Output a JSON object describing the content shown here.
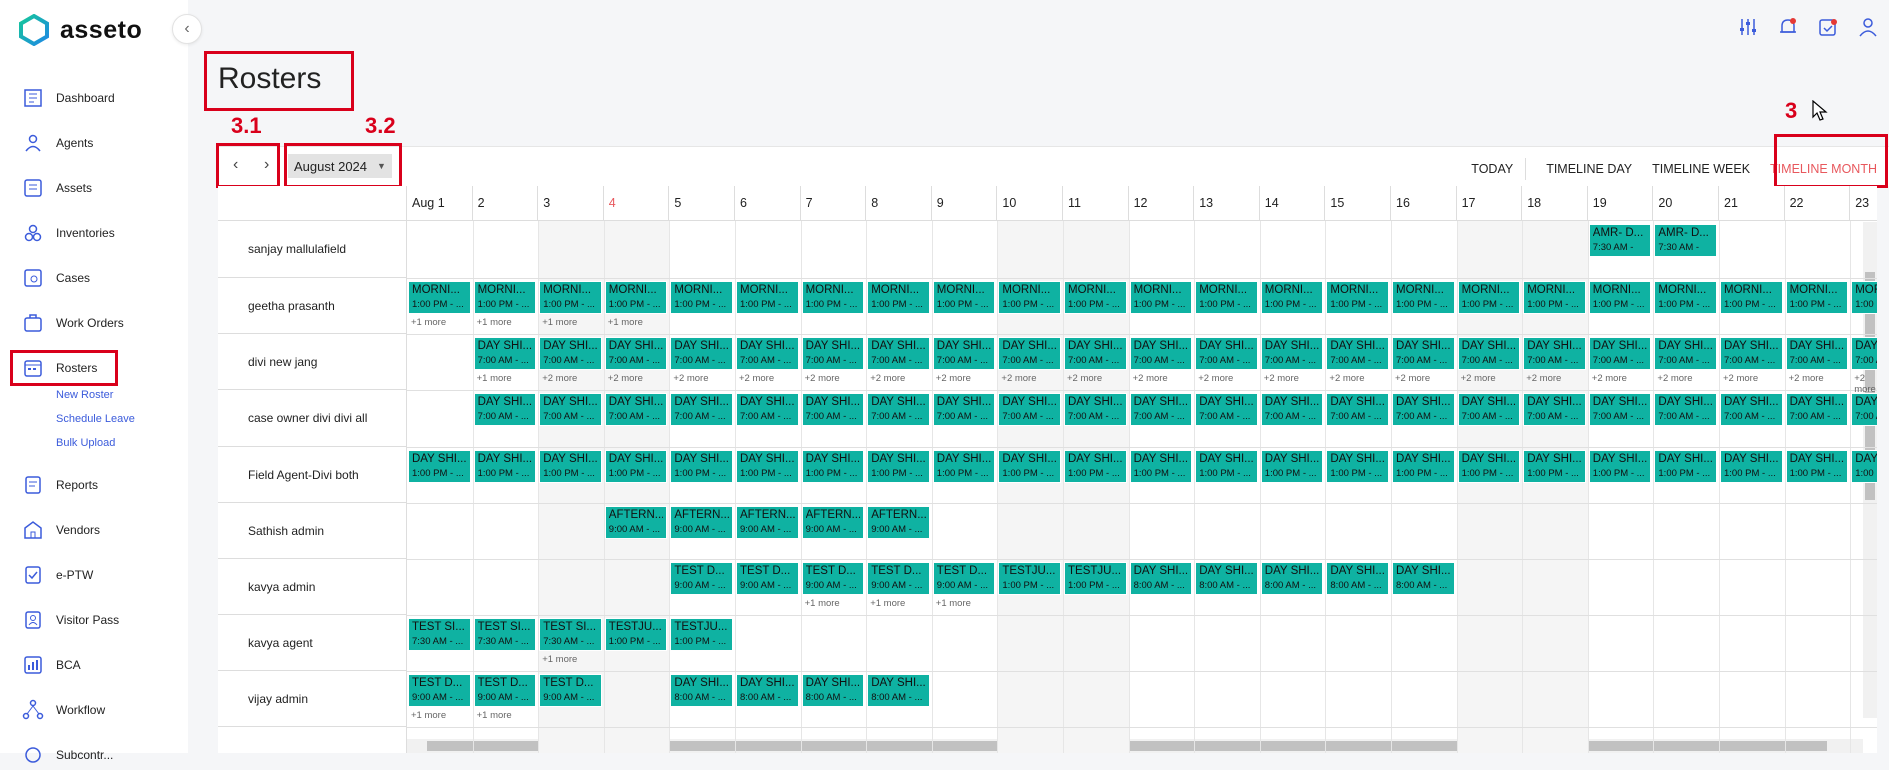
{
  "brand": {
    "name": "asseto"
  },
  "sidebar": {
    "items": [
      {
        "label": "Dashboard",
        "icon": "dashboard-icon"
      },
      {
        "label": "Agents",
        "icon": "agents-icon"
      },
      {
        "label": "Assets",
        "icon": "assets-icon"
      },
      {
        "label": "Inventories",
        "icon": "inventories-icon"
      },
      {
        "label": "Cases",
        "icon": "cases-icon"
      },
      {
        "label": "Work Orders",
        "icon": "work-orders-icon"
      },
      {
        "label": "Rosters",
        "icon": "rosters-icon"
      },
      {
        "label": "Reports",
        "icon": "reports-icon"
      },
      {
        "label": "Vendors",
        "icon": "vendors-icon"
      },
      {
        "label": "e-PTW",
        "icon": "eptw-icon"
      },
      {
        "label": "Visitor Pass",
        "icon": "visitor-pass-icon"
      },
      {
        "label": "BCA",
        "icon": "bca-icon"
      },
      {
        "label": "Workflow",
        "icon": "workflow-icon"
      },
      {
        "label": "Subcontr...",
        "icon": "subcontractor-icon"
      }
    ],
    "subitems": [
      "New Roster",
      "Schedule Leave",
      "Bulk Upload"
    ]
  },
  "header": {
    "icons": [
      "settings-sliders-icon",
      "notification-bell-icon",
      "calendar-check-icon",
      "user-icon"
    ]
  },
  "page": {
    "title": "Rosters"
  },
  "annotations": {
    "a31": "3.1",
    "a32": "3.2",
    "a3": "3"
  },
  "toolbar": {
    "month": "August 2024",
    "views": [
      "TODAY",
      "TIMELINE DAY",
      "TIMELINE WEEK",
      "TIMELINE MONTH"
    ],
    "active_view": "TIMELINE MONTH"
  },
  "calendar": {
    "dates": [
      "Aug 1",
      "2",
      "3",
      "4",
      "5",
      "6",
      "7",
      "8",
      "9",
      "10",
      "11",
      "12",
      "13",
      "14",
      "15",
      "16",
      "17",
      "18",
      "19",
      "20",
      "21",
      "22",
      "23"
    ],
    "today_index": 3,
    "weekend_indexes": [
      2,
      3,
      9,
      10,
      16,
      17
    ],
    "resources": [
      "sanjay mallulafield",
      "geetha prasanth",
      "divi new jang",
      "case owner divi divi all",
      "Field Agent-Divi both",
      "Sathish admin",
      "kavya admin",
      "kavya agent",
      "vijay admin"
    ]
  },
  "events_text": {
    "more": "+1 more",
    "more2": "+2 more",
    "amr_t": "AMR- D...",
    "amr_s": "7:30 AM -",
    "morn_t": "MORNI...",
    "morn_s": "1:00 PM - ...",
    "day_t": "DAY SHI...",
    "day7_s": "7:00 AM - ...",
    "day1_s": "1:00 PM - ...",
    "day8_s": "8:00 AM - ...",
    "aft_t": "AFTERN...",
    "aft_s": "9:00 AM - ...",
    "testd_t": "TEST D...",
    "testd_s": "9:00 AM - ...",
    "testju_t": "TESTJU...",
    "testju_s": "1:00 PM - ...",
    "testsi_t": "TEST SI...",
    "testsi_s": "7:30 AM - ..."
  }
}
